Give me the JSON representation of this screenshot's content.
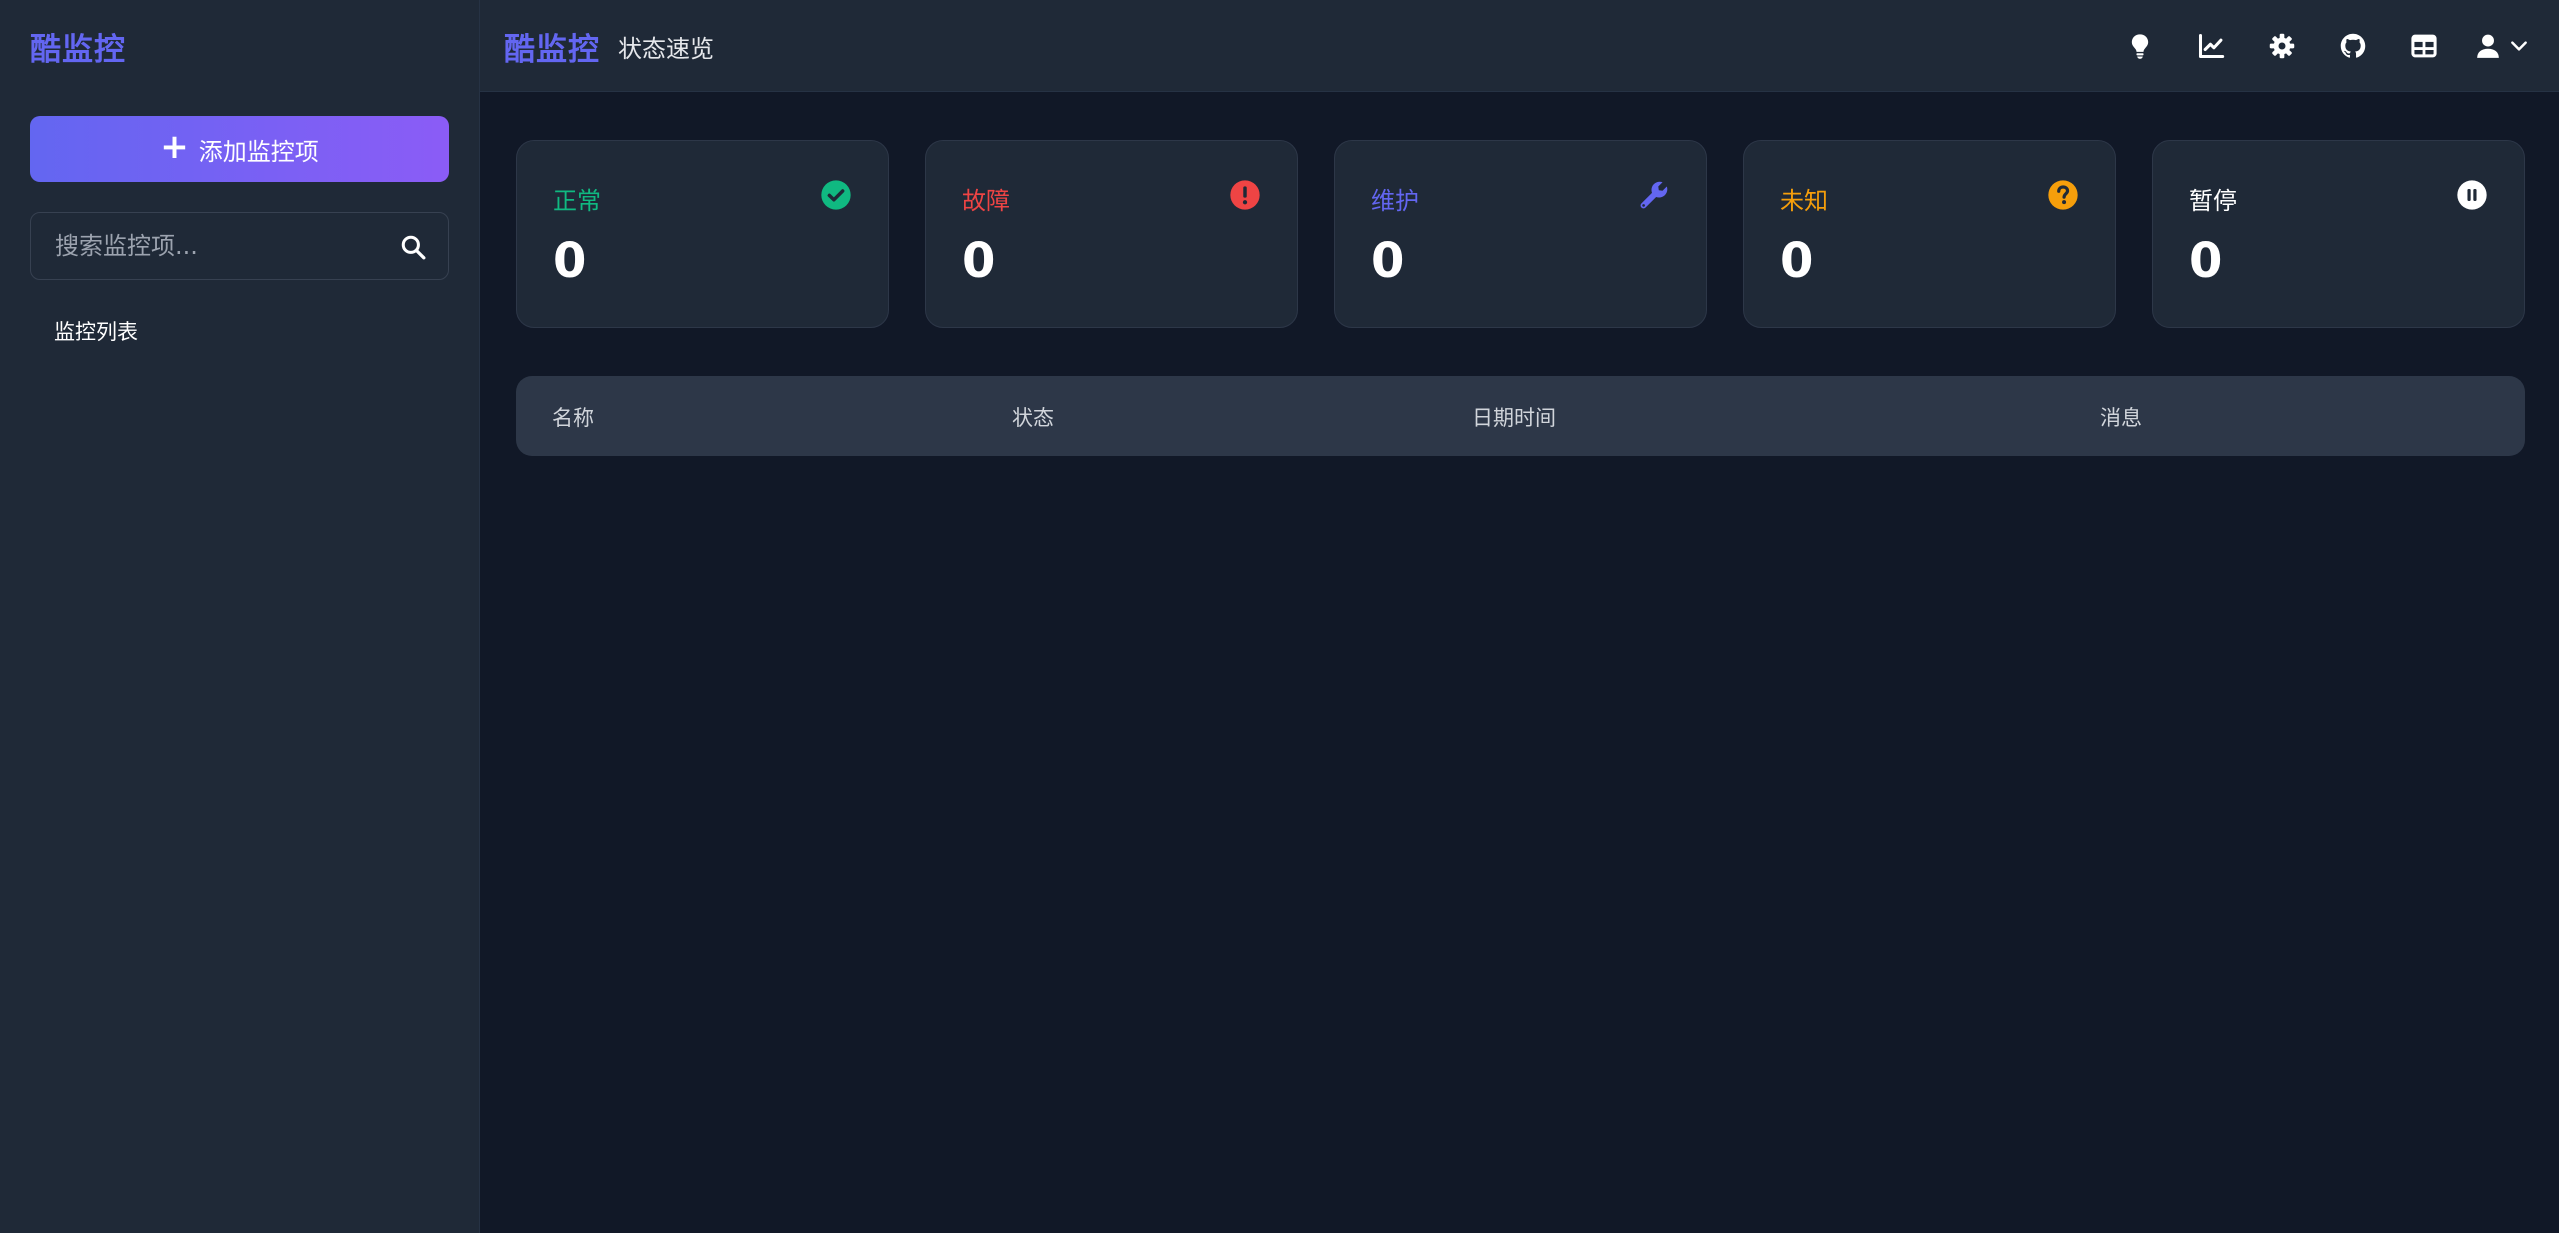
{
  "app": {
    "brand": "酷监控",
    "page_subtitle": "状态速览"
  },
  "sidebar": {
    "add_button_label": "添加监控项",
    "search_placeholder": "搜索监控项...",
    "list_title": "监控列表"
  },
  "header": {
    "icons": [
      "lightbulb-icon",
      "chart-line-icon",
      "gear-icon",
      "github-icon",
      "table-icon",
      "user-icon",
      "chevron-down-icon"
    ]
  },
  "stats": [
    {
      "label": "正常",
      "value": "0",
      "color": "#10b981",
      "icon": "check-circle-icon"
    },
    {
      "label": "故障",
      "value": "0",
      "color": "#ef4444",
      "icon": "exclamation-circle-icon"
    },
    {
      "label": "维护",
      "value": "0",
      "color": "#6366f1",
      "icon": "wrench-icon"
    },
    {
      "label": "未知",
      "value": "0",
      "color": "#f59e0b",
      "icon": "question-circle-icon"
    },
    {
      "label": "暂停",
      "value": "0",
      "color": "#ffffff",
      "icon": "pause-circle-icon"
    }
  ],
  "table": {
    "columns": [
      "名称",
      "状态",
      "日期时间",
      "消息"
    ]
  },
  "colors": {
    "accent": "#6366f1",
    "accent_gradient_end": "#8b5cf6",
    "background": "#111827",
    "panel": "#1f2937"
  }
}
